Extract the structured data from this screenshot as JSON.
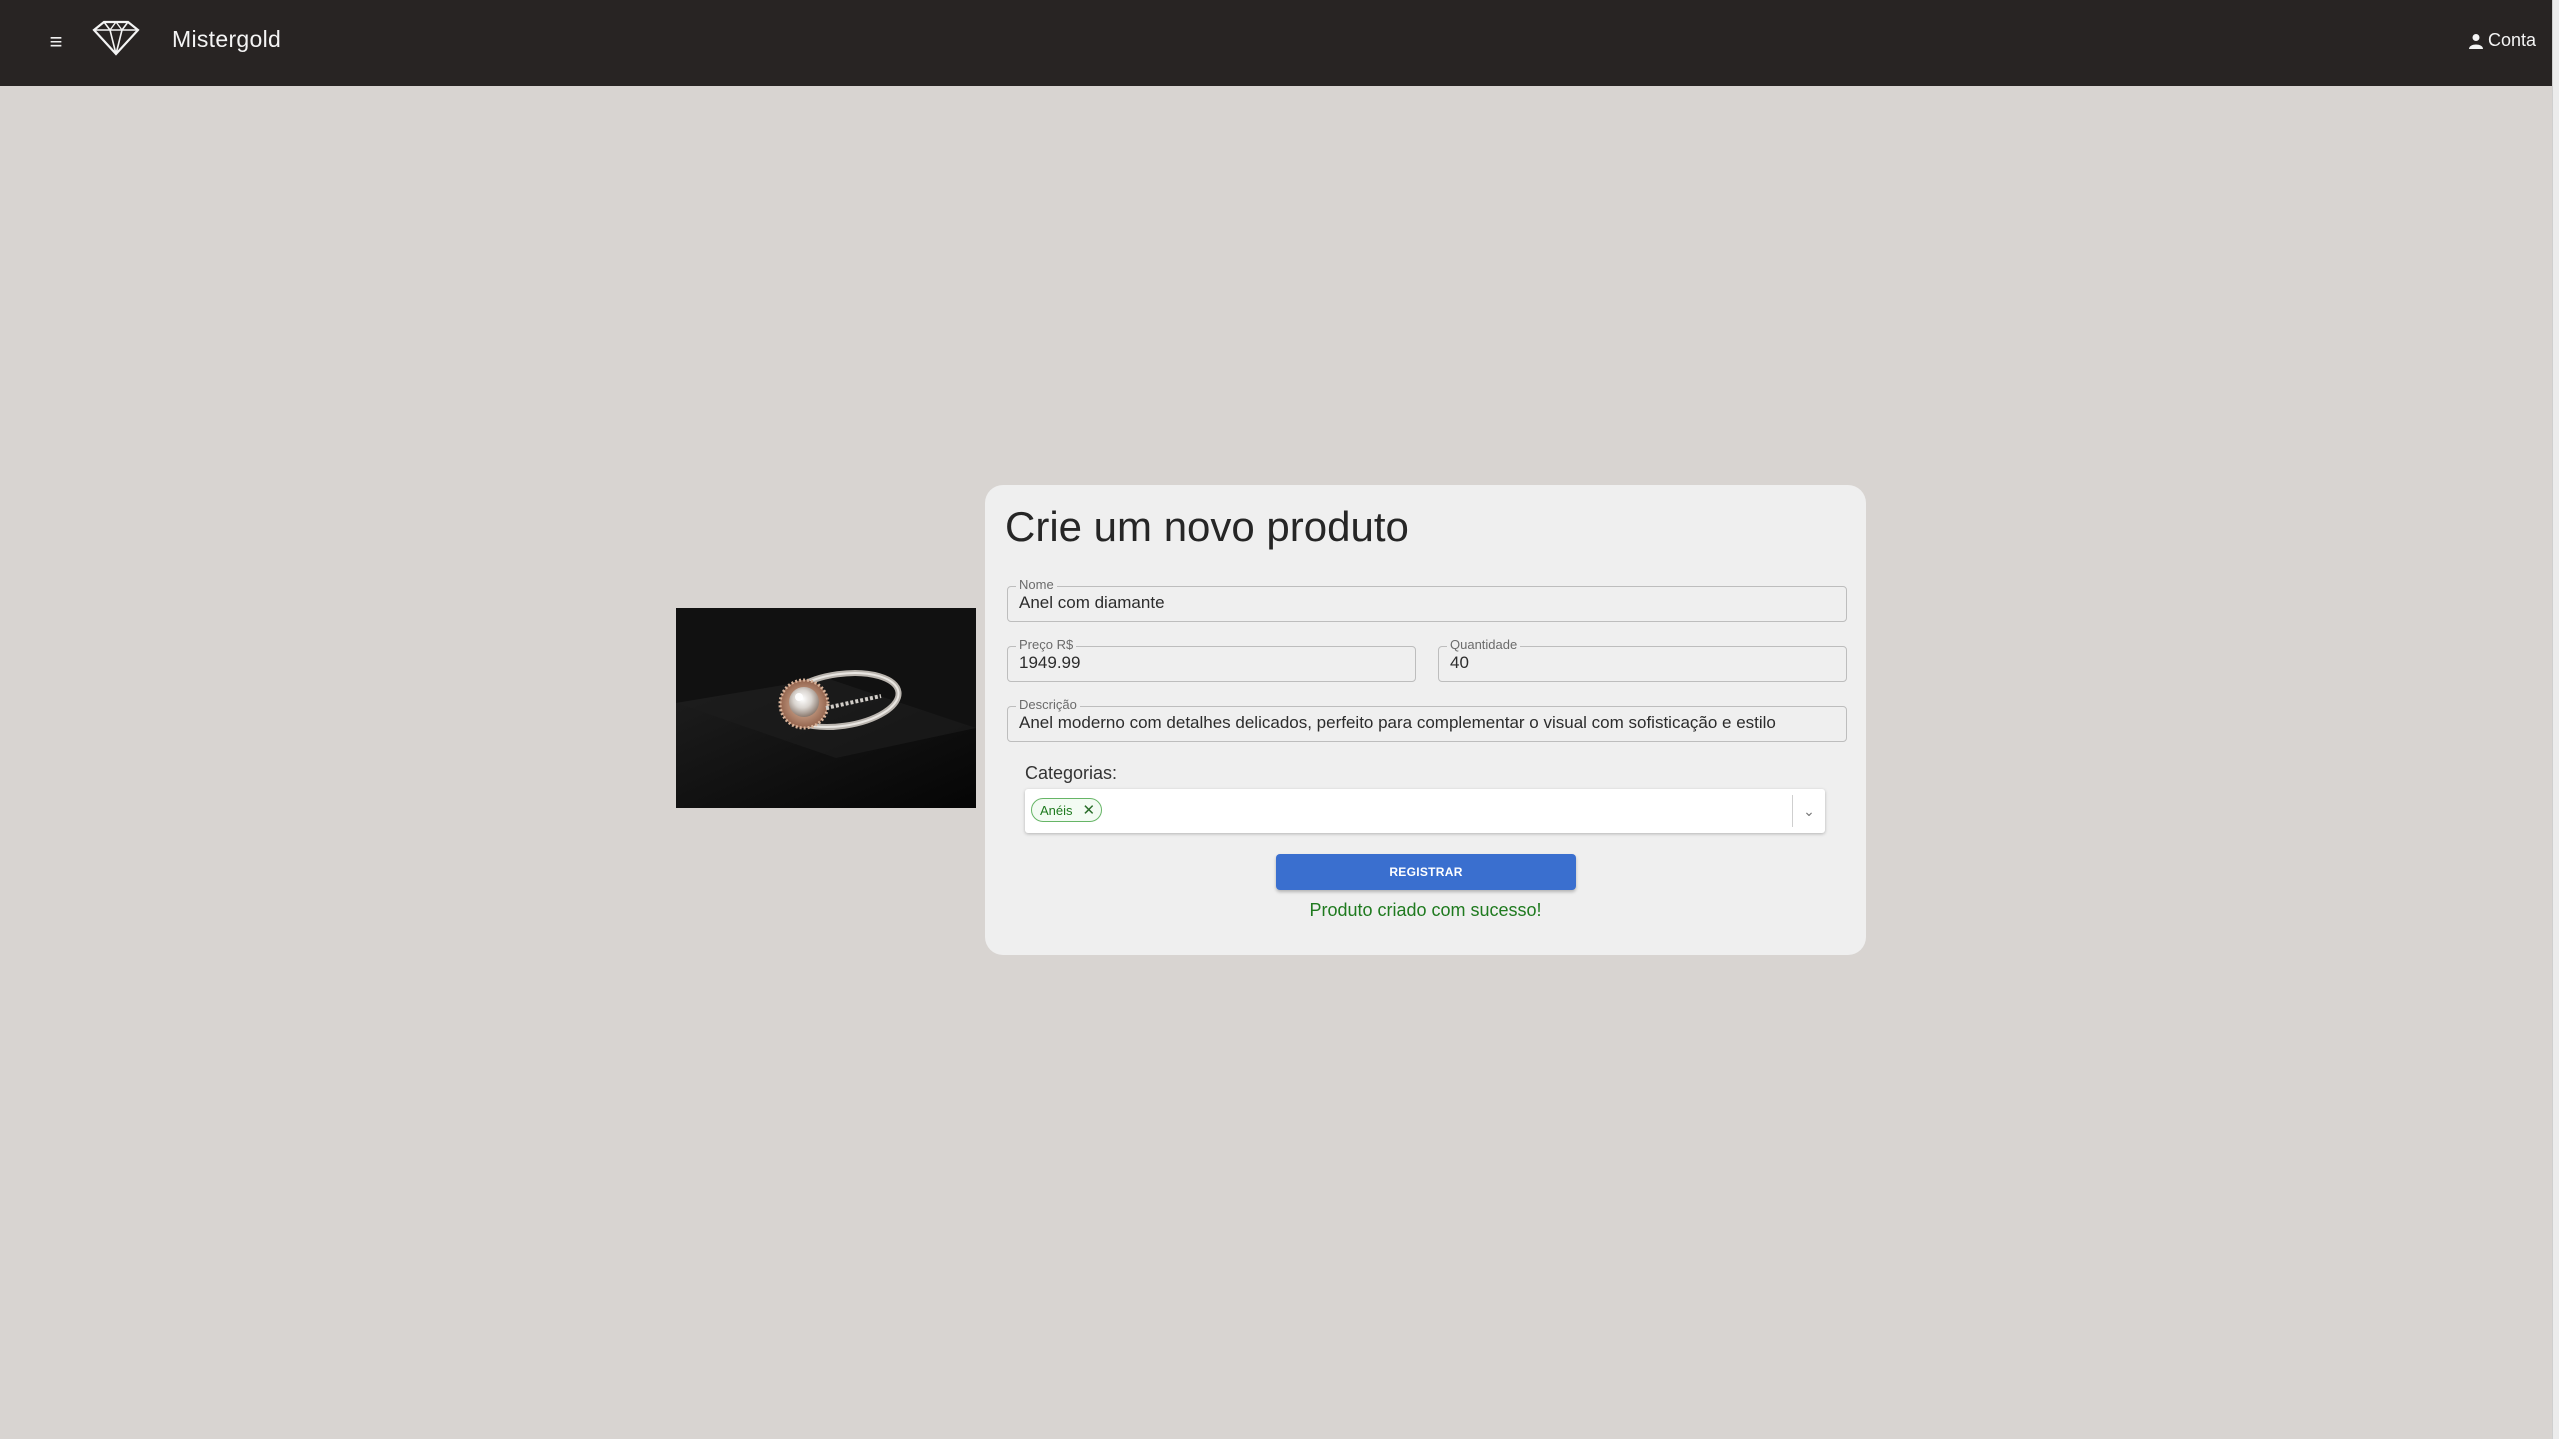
{
  "header": {
    "brand": "Mistergold",
    "account_label": "Conta",
    "menu_icon": "hamburger-menu-icon",
    "logo_icon": "diamond-logo-icon"
  },
  "form": {
    "title": "Crie um novo produto",
    "name": {
      "legend": "Nome",
      "value": "Anel com diamante"
    },
    "price": {
      "legend": "Preço R$",
      "value": "1949.99"
    },
    "quantity": {
      "legend": "Quantidade",
      "value": "40"
    },
    "description": {
      "legend": "Descrição",
      "value": "Anel moderno com detalhes delicados, perfeito para complementar o visual com sofisticação e estilo"
    },
    "categories": {
      "label": "Categorias:",
      "selected": [
        "Anéis"
      ]
    },
    "submit_label": "REGISTRAR",
    "success_message": "Produto criado com sucesso!"
  },
  "colors": {
    "header_bg": "#282423",
    "page_bg": "#d8d4d1",
    "card_bg": "#efefef",
    "button_bg": "#3a6fcf",
    "success_text": "#1f7a1f"
  }
}
